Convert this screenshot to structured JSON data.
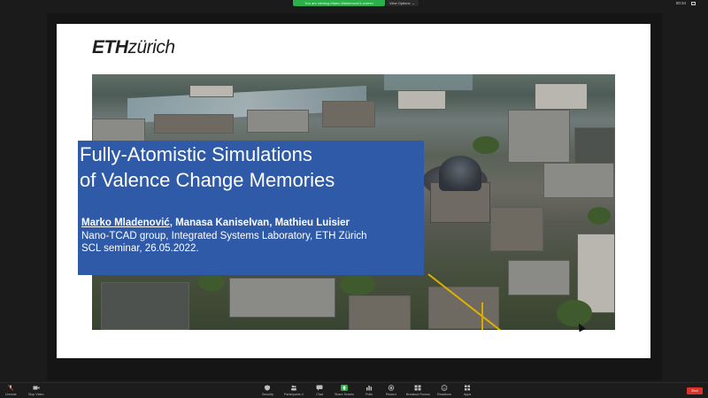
{
  "topbar": {
    "sharing_notice": "You are viewing Marko Mladenović's screen",
    "view_options": "View Options",
    "time": "00:34"
  },
  "slide": {
    "logo": {
      "eth": "ETH",
      "zurich": "zürich"
    },
    "title_line1": "Fully-Atomistic Simulations",
    "title_line2": "of Valence Change Memories",
    "authors_main": "Marko Mladenović",
    "authors_rest": ", Manasa Kaniselvan, Mathieu Luisier",
    "affiliation": "Nano-TCAD group, Integrated Systems Laboratory, ETH Zürich",
    "event": "SCL seminar, 26.05.2022."
  },
  "toolbar": {
    "unmute": "Unmute",
    "stop_video": "Stop Video",
    "security": "Security",
    "participants": "Participants",
    "participants_count": "4",
    "chat": "Chat",
    "share_screen": "Share Screen",
    "polls": "Polls",
    "record": "Record",
    "breakout_rooms": "Breakout Rooms",
    "reactions": "Reactions",
    "apps": "Apps",
    "end": "End"
  },
  "colors": {
    "title_box": "#2f5aa8",
    "share_green": "#2bb04a",
    "end_red": "#d9332b"
  }
}
